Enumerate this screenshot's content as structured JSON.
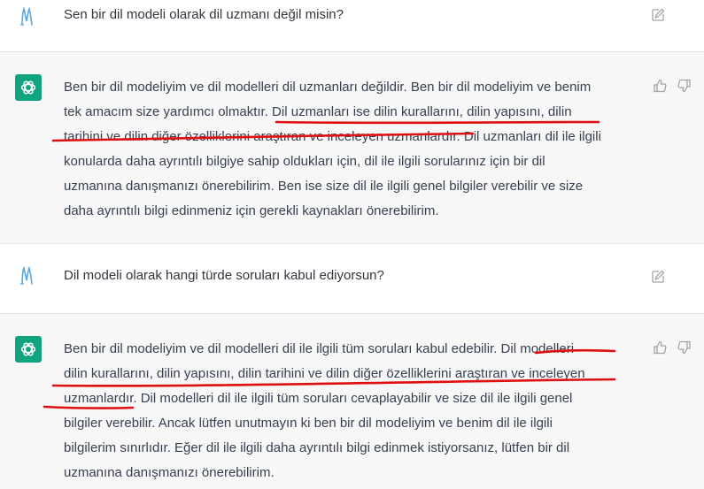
{
  "conversation": [
    {
      "role": "user",
      "text": "Sen bir dil modeli olarak dil uzmanı değil misin?"
    },
    {
      "role": "assistant",
      "lines": [
        "Ben bir dil modeliyim ve dil modelleri dil uzmanları değildir. Ben bir dil modeliyim ve benim",
        "tek amacım size yardımcı olmaktır. Dil uzmanları ise dilin kurallarını, dilin yapısını, dilin",
        "tarihini ve dilin diğer özelliklerini araştıran ve inceleyen uzmanlardır. Dil uzmanları dil ile ilgili",
        "konularda daha ayrıntılı bilgiye sahip oldukları için, dil ile ilgili sorularınız için bir dil",
        "uzmanına danışmanızı önerebilirim. Ben ise size dil ile ilgili genel bilgiler verebilir ve size",
        "daha ayrıntılı bilgi edinmeniz için gerekli kaynakları önerebilirim."
      ]
    },
    {
      "role": "user",
      "text": "Dil modeli olarak hangi türde soruları kabul ediyorsun?"
    },
    {
      "role": "assistant",
      "lines": [
        "Ben bir dil modeliyim ve dil modelleri dil ile ilgili tüm soruları kabul edebilir. Dil modelleri",
        "dilin kurallarını, dilin yapısını, dilin tarihini ve dilin diğer özelliklerini araştıran ve inceleyen",
        "uzmanlardır. Dil modelleri dil ile ilgili tüm soruları cevaplayabilir ve size dil ile ilgili genel",
        "bilgiler verebilir. Ancak lütfen unutmayın ki ben bir dil modeliyim ve benim dil ile ilgili",
        "bilgilerim sınırlıdır. Eğer dil ile ilgili daha ayrıntılı bilgi edinmek istiyorsanız, lütfen bir dil",
        "uzmanına danışmanızı önerebilirim."
      ]
    }
  ],
  "icons": {
    "user_avatar": "user-initial-m-icon",
    "bot_avatar": "openai-logo-icon",
    "edit": "edit-icon",
    "thumbs_up": "thumbs-up-icon",
    "thumbs_down": "thumbs-down-icon"
  },
  "colors": {
    "assistant_bg": "#f7f7f8",
    "user_bg": "#ffffff",
    "bot_avatar_bg": "#10a37f",
    "user_avatar_stroke": "#5aa7e6",
    "annotation_red": "#e01010"
  }
}
